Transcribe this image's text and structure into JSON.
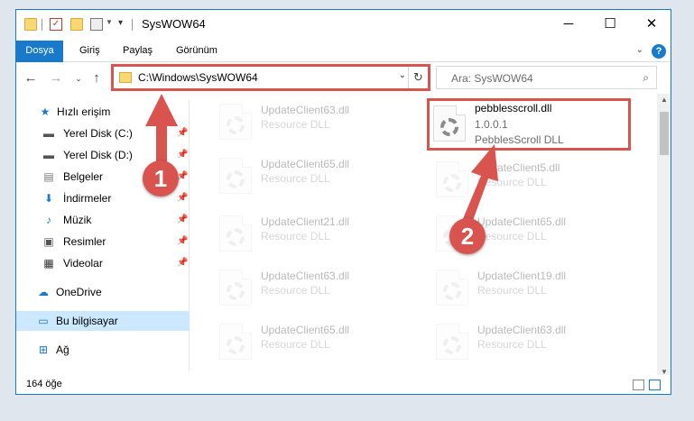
{
  "window": {
    "title": "SysWOW64"
  },
  "ribbon": {
    "tabs": [
      "Dosya",
      "Giriş",
      "Paylaş",
      "Görünüm"
    ],
    "help": "?"
  },
  "navigation": {
    "address": "C:\\Windows\\SysWOW64",
    "search_placeholder": "Ara: SysWOW64"
  },
  "sidebar": {
    "items": [
      {
        "label": "Hızlı erişim",
        "icon": "star-icon",
        "pinned": false
      },
      {
        "label": "Yerel Disk (C:)",
        "icon": "drive-icon",
        "pinned": true
      },
      {
        "label": "Yerel Disk (D:)",
        "icon": "drive-icon",
        "pinned": true
      },
      {
        "label": "Belgeler",
        "icon": "documents-icon",
        "pinned": true
      },
      {
        "label": "İndirmeler",
        "icon": "download-icon",
        "pinned": true
      },
      {
        "label": "Müzik",
        "icon": "music-icon",
        "pinned": true
      },
      {
        "label": "Resimler",
        "icon": "pictures-icon",
        "pinned": true
      },
      {
        "label": "Videolar",
        "icon": "videos-icon",
        "pinned": true
      },
      {
        "label": "OneDrive",
        "icon": "cloud-icon",
        "pinned": false
      },
      {
        "label": "Bu bilgisayar",
        "icon": "computer-icon",
        "pinned": false
      },
      {
        "label": "Ağ",
        "icon": "network-icon",
        "pinned": false
      }
    ]
  },
  "files": {
    "left_column": [
      {
        "name": "UpdateClient63.dll",
        "type": "Resource DLL"
      },
      {
        "name": "UpdateClient65.dll",
        "type": "Resource DLL"
      },
      {
        "name": "UpdateClient21.dll",
        "type": "Resource DLL"
      },
      {
        "name": "UpdateClient63.dll",
        "type": "Resource DLL"
      },
      {
        "name": "UpdateClient65.dll",
        "type": "Resource DLL"
      }
    ],
    "highlighted": {
      "name": "pebblesscroll.dll",
      "version": "1.0.0.1",
      "description": "PebblesScroll DLL"
    },
    "right_column": [
      {
        "name": "UpdateClient5.dll",
        "type": "Resource DLL"
      },
      {
        "name": "UpdateClient65.dll",
        "type": "Resource DLL"
      },
      {
        "name": "UpdateClient19.dll",
        "type": "Resource DLL"
      },
      {
        "name": "UpdateClient63.dll",
        "type": "Resource DLL"
      }
    ]
  },
  "status": {
    "item_count": "164 öğe"
  },
  "callouts": [
    "1",
    "2"
  ],
  "colors": {
    "accent": "#1979ca",
    "highlight": "#d9534f"
  }
}
